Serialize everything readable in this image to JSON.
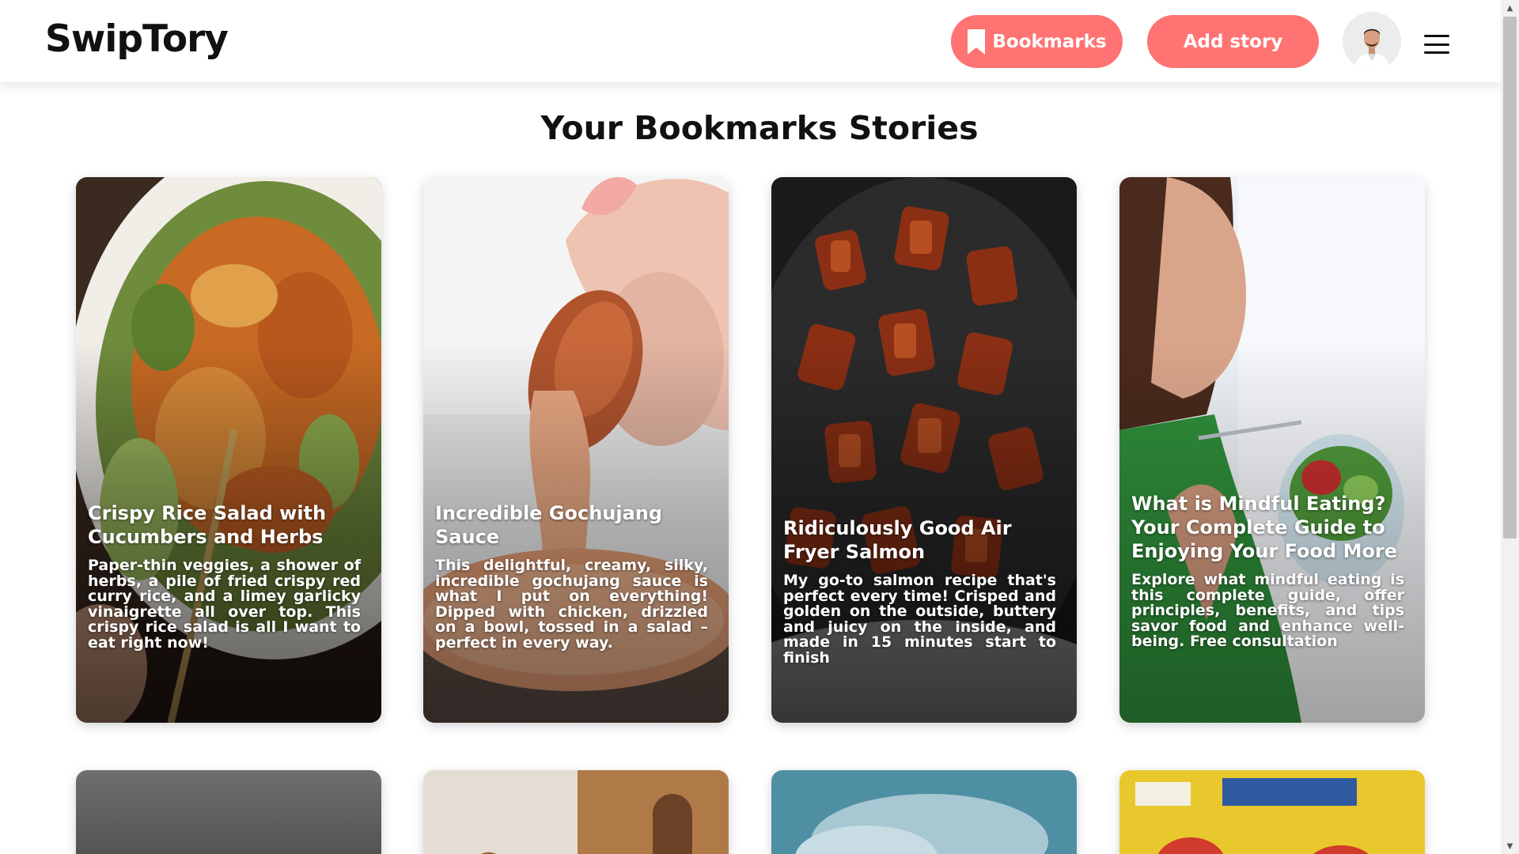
{
  "app": {
    "logo": "SwipTory"
  },
  "header": {
    "bookmarks_label": "Bookmarks",
    "add_story_label": "Add story",
    "accent_color": "#ff7373"
  },
  "main": {
    "title": "Your Bookmarks Stories",
    "cards": [
      {
        "title": "Crispy Rice Salad with Cucumbers and Herbs",
        "description": "Paper-thin veggies, a shower of herbs, a pile of fried crispy red curry rice, and a limey garlicky vinaigrette all over top. This crispy rice salad is all I want to eat right now!"
      },
      {
        "title": "Incredible Gochujang Sauce",
        "description": "This delightful, creamy, silky, incredible gochujang sauce is what I put on everything! Dipped with chicken, drizzled on a bowl, tossed in a salad – perfect in every way."
      },
      {
        "title": "Ridiculously Good Air Fryer Salmon",
        "description": "My go-to salmon recipe that's perfect every time! Crisped and golden on the outside, buttery and juicy on the inside, and made in 15 minutes start to finish"
      },
      {
        "title": "What is Mindful Eating? Your Complete Guide to Enjoying Your Food More",
        "description": "Explore what mindful eating is this complete guide, offer principles, benefits, and tips savor food and enhance well-being. Free consultation"
      }
    ]
  }
}
